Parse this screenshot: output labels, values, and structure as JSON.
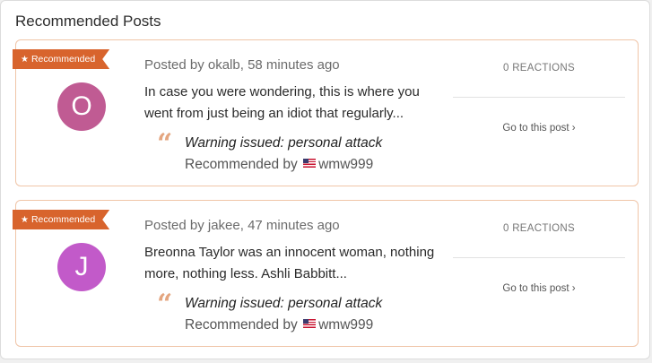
{
  "title": "Recommended Posts",
  "ribbon_label": "Recommended",
  "posts": [
    {
      "avatar_letter": "O",
      "byline": "Posted by okalb, 58 minutes ago",
      "excerpt": "In case you were wondering, this is where you went from just being an idiot that regularly...",
      "reason": "Warning issued: personal attack",
      "recommended_by_prefix": "Recommended by",
      "recommended_by_user": "wmw999",
      "reactions": "0 REACTIONS",
      "goto_label": "Go to this post ›",
      "avatar_color": "#c05b93"
    },
    {
      "avatar_letter": "J",
      "byline": "Posted by jakee, 47 minutes ago",
      "excerpt": "Breonna Taylor was an innocent woman, nothing more, nothing less.   Ashli Babbitt...",
      "reason": "Warning issued: personal attack",
      "recommended_by_prefix": "Recommended by",
      "recommended_by_user": "wmw999",
      "reactions": "0 REACTIONS",
      "goto_label": "Go to this post ›",
      "avatar_color": "#c25ac9"
    }
  ],
  "colors": {
    "ribbon": "#d8642d",
    "card_border": "#f0c5a8",
    "quote_icon": "#e4a57f"
  },
  "icons": {
    "ribbon": "star-icon",
    "quote": "quote-icon",
    "flag": "us-flag-icon"
  }
}
